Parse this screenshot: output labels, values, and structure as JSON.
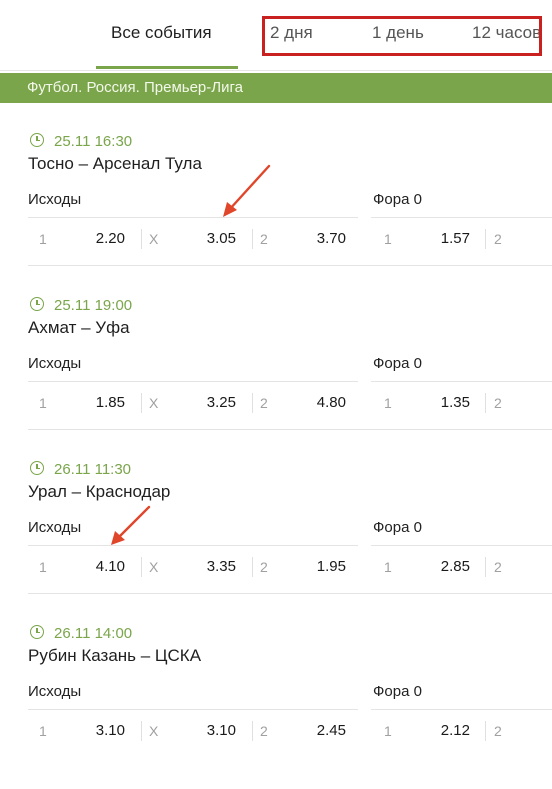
{
  "tabs": {
    "all": "Все события",
    "two_days": "2 дня",
    "one_day": "1 день",
    "twelve_hours": "12 часов"
  },
  "league": "Футбол. Россия. Премьер-Лига",
  "events": [
    {
      "time": "25.11 16:30",
      "teams": "Тосно – Арсенал Тула",
      "market1": "Исходы",
      "market2": "Фора 0",
      "l1": "1",
      "o1": "2.20",
      "lx": "X",
      "ox": "3.05",
      "l2": "2",
      "o2": "3.70",
      "h1": "1",
      "ho1": "1.57",
      "h2": "2"
    },
    {
      "time": "25.11 19:00",
      "teams": "Ахмат – Уфа",
      "market1": "Исходы",
      "market2": "Фора 0",
      "l1": "1",
      "o1": "1.85",
      "lx": "X",
      "ox": "3.25",
      "l2": "2",
      "o2": "4.80",
      "h1": "1",
      "ho1": "1.35",
      "h2": "2"
    },
    {
      "time": "26.11 11:30",
      "teams": "Урал – Краснодар",
      "market1": "Исходы",
      "market2": "Фора 0",
      "l1": "1",
      "o1": "4.10",
      "lx": "X",
      "ox": "3.35",
      "l2": "2",
      "o2": "1.95",
      "h1": "1",
      "ho1": "2.85",
      "h2": "2"
    },
    {
      "time": "26.11 14:00",
      "teams": "Рубин Казань – ЦСКА",
      "market1": "Исходы",
      "market2": "Фора 0",
      "l1": "1",
      "o1": "3.10",
      "lx": "X",
      "ox": "3.10",
      "l2": "2",
      "o2": "2.45",
      "h1": "1",
      "ho1": "2.12",
      "h2": "2"
    }
  ],
  "colors": {
    "accent_green": "#7aa54b",
    "highlight_red": "#c8211f",
    "arrow": "#e0462a"
  },
  "icons": {
    "clock": "clock-icon",
    "arrow": "red-arrow-annotation"
  }
}
